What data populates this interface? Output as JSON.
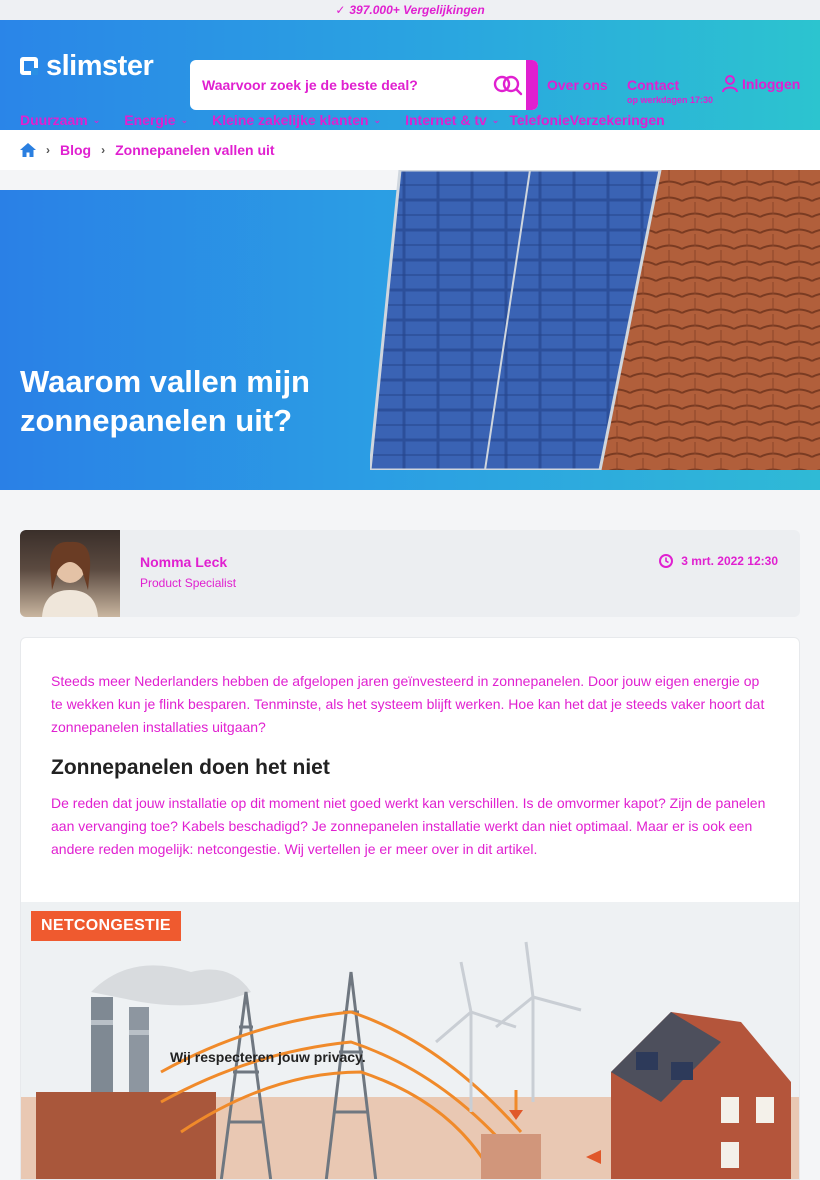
{
  "topstrip": {
    "text": "397.000+ Vergelijkingen"
  },
  "header": {
    "logo": "slimster",
    "search_placeholder": "Waarvoor zoek je de beste deal?",
    "links": [
      {
        "label": "Over ons"
      },
      {
        "label": "Contact",
        "sub": "op werkdagen 17:30"
      },
      {
        "label": "Inloggen"
      }
    ],
    "nav": [
      {
        "label": "Duurzaam"
      },
      {
        "label": "Energie"
      },
      {
        "label": "Kleine zakelijke klanten"
      },
      {
        "label": "Internet & tv"
      },
      {
        "label": "Telefonie"
      },
      {
        "label": "Verzekeringen"
      }
    ]
  },
  "breadcrumb": {
    "items": [
      "Blog",
      "Zonnepanelen vallen uit"
    ]
  },
  "hero": {
    "title": "Waarom vallen mijn zonnepanelen uit?"
  },
  "author": {
    "name": "Nomma Leck",
    "role": "Product Specialist",
    "date": "3 mrt. 2022 12:30"
  },
  "article": {
    "intro": "Steeds meer Nederlanders hebben de afgelopen jaren geïnvesteerd in zonnepanelen. Door jouw eigen energie op te wekken kun je flink besparen. Tenminste, als het systeem blijft werken. Hoe kan het dat je steeds vaker hoort dat zonnepanelen installaties uitgaan?",
    "h2": "Zonnepanelen doen het niet",
    "para": "De reden dat jouw installatie op dit moment niet goed werkt kan verschillen. Is de omvormer kapot? Zijn de panelen aan vervanging toe? Kabels beschadigd? Je zonnepanelen installatie werkt dan niet optimaal. Maar er is ook een andere reden mogelijk: netcongestie. Wij vertellen je er meer over in dit artikel.",
    "figure_tag": "NETCONGESTIE"
  },
  "overlay": {
    "privacy": "Wij respecteren jouw privacy."
  }
}
